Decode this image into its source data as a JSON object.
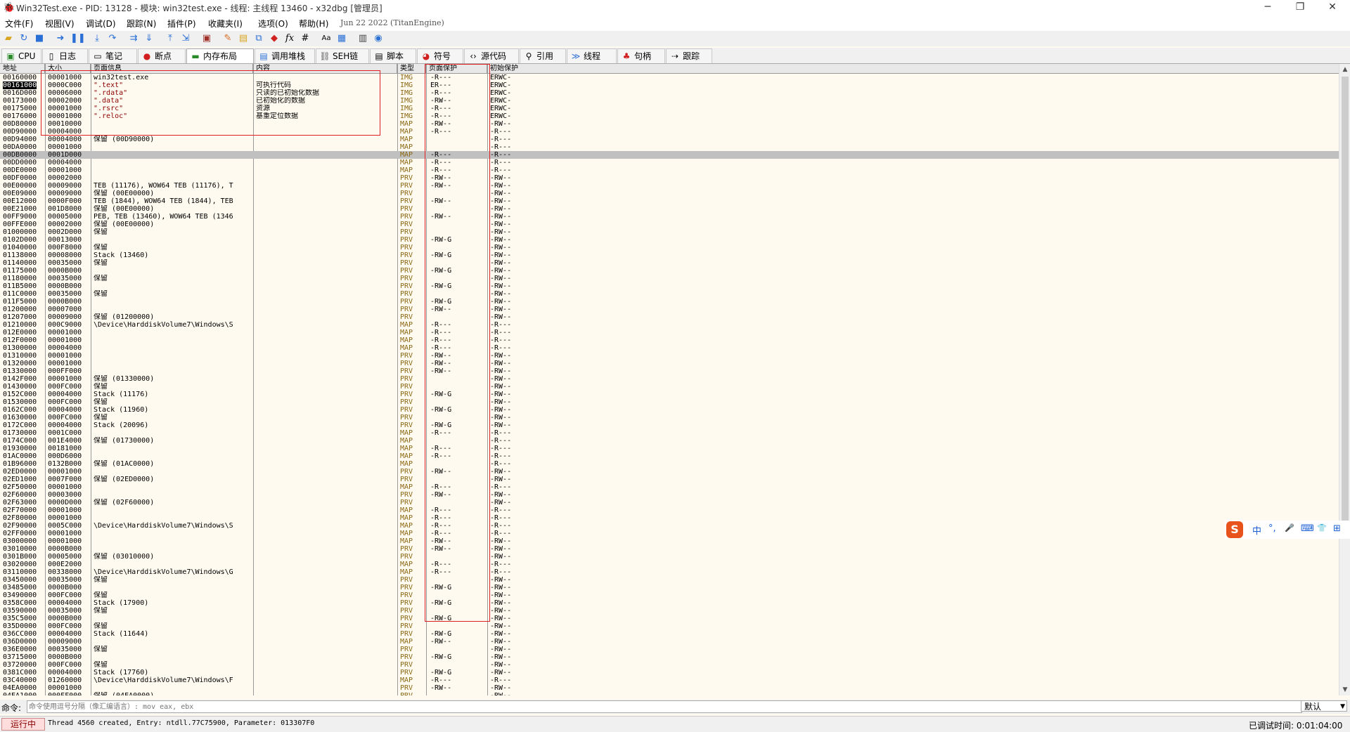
{
  "window": {
    "title": "Win32Test.exe - PID: 13128 - 模块: win32test.exe - 线程: 主线程 13460 - x32dbg [管理员]",
    "minimize": "─",
    "maximize": "❐",
    "close": "✕"
  },
  "menu": {
    "items": [
      "文件(F)",
      "视图(V)",
      "调试(D)",
      "跟踪(N)",
      "插件(P)",
      "收藏夹(I)",
      "选项(O)",
      "帮助(H)"
    ],
    "build": "Jun 22 2022 (TitanEngine)"
  },
  "tabs": [
    {
      "label": "CPU",
      "icon": "cpu-icon"
    },
    {
      "label": "日志",
      "icon": "log-icon"
    },
    {
      "label": "笔记",
      "icon": "notes-icon"
    },
    {
      "label": "断点",
      "icon": "breakpoint-icon"
    },
    {
      "label": "内存布局",
      "icon": "memory-map-icon"
    },
    {
      "label": "调用堆栈",
      "icon": "call-stack-icon"
    },
    {
      "label": "SEH链",
      "icon": "seh-chain-icon"
    },
    {
      "label": "脚本",
      "icon": "script-icon"
    },
    {
      "label": "符号",
      "icon": "symbols-icon"
    },
    {
      "label": "源代码",
      "icon": "source-icon"
    },
    {
      "label": "引用",
      "icon": "references-icon"
    },
    {
      "label": "线程",
      "icon": "threads-icon"
    },
    {
      "label": "句柄",
      "icon": "handles-icon"
    },
    {
      "label": "跟踪",
      "icon": "trace-icon"
    }
  ],
  "table": {
    "headers": [
      "地址",
      "大小",
      "页面信息",
      "内容",
      "类型",
      "页面保护",
      "初始保护"
    ],
    "rows": [
      [
        "00160000",
        "00001000",
        "win32test.exe",
        "",
        "IMG",
        "-R---",
        "ERWC-"
      ],
      [
        "00161000",
        "0000C000",
        "\".text\"",
        "可执行代码",
        "IMG",
        "ER---",
        "ERWC-"
      ],
      [
        "0016D000",
        "00006000",
        "\".rdata\"",
        "只读的已初始化数据",
        "IMG",
        "-R---",
        "ERWC-"
      ],
      [
        "00173000",
        "00002000",
        "\".data\"",
        "已初始化的数据",
        "IMG",
        "-RW--",
        "ERWC-"
      ],
      [
        "00175000",
        "00001000",
        "\".rsrc\"",
        "资源",
        "IMG",
        "-R---",
        "ERWC-"
      ],
      [
        "00176000",
        "00001000",
        "\".reloc\"",
        "基重定位数据",
        "IMG",
        "-R---",
        "ERWC-"
      ],
      [
        "00D80000",
        "00010000",
        "",
        "",
        "MAP",
        "-RW--",
        "-RW--"
      ],
      [
        "00D90000",
        "00004000",
        "",
        "",
        "MAP",
        "-R---",
        "-R---"
      ],
      [
        "00D94000",
        "00004000",
        "保留 (00D90000)",
        "",
        "MAP",
        "",
        "-R---"
      ],
      [
        "00DA0000",
        "00001000",
        "",
        "",
        "MAP",
        "",
        "-R---"
      ],
      [
        "00DB0000",
        "0001D000",
        "",
        "",
        "MAP",
        "-R---",
        "-R---"
      ],
      [
        "00DD0000",
        "00004000",
        "",
        "",
        "MAP",
        "-R---",
        "-R---"
      ],
      [
        "00DE0000",
        "00001000",
        "",
        "",
        "MAP",
        "-R---",
        "-R---"
      ],
      [
        "00DF0000",
        "00002000",
        "",
        "",
        "PRV",
        "-RW--",
        "-RW--"
      ],
      [
        "00E00000",
        "00009000",
        "TEB (11176), WOW64 TEB (11176), T",
        "",
        "PRV",
        "-RW--",
        "-RW--"
      ],
      [
        "00E09000",
        "00009000",
        "保留 (00E00000)",
        "",
        "PRV",
        "",
        "-RW--"
      ],
      [
        "00E12000",
        "0000F000",
        "TEB (1844), WOW64 TEB (1844), TEB",
        "",
        "PRV",
        "-RW--",
        "-RW--"
      ],
      [
        "00E21000",
        "001D8000",
        "保留 (00E00000)",
        "",
        "PRV",
        "",
        "-RW--"
      ],
      [
        "00FF9000",
        "00005000",
        "PEB, TEB (13460), WOW64 TEB (1346",
        "",
        "PRV",
        "-RW--",
        "-RW--"
      ],
      [
        "00FFE000",
        "00002000",
        "保留 (00E00000)",
        "",
        "PRV",
        "",
        "-RW--"
      ],
      [
        "01000000",
        "0002D000",
        "保留",
        "",
        "PRV",
        "",
        "-RW--"
      ],
      [
        "0102D000",
        "00013000",
        "",
        "",
        "PRV",
        "-RW-G",
        "-RW--"
      ],
      [
        "01040000",
        "000F8000",
        "保留",
        "",
        "PRV",
        "",
        "-RW--"
      ],
      [
        "01138000",
        "00008000",
        "Stack (13460)",
        "",
        "PRV",
        "-RW-G",
        "-RW--"
      ],
      [
        "01140000",
        "00035000",
        "保留",
        "",
        "PRV",
        "",
        "-RW--"
      ],
      [
        "01175000",
        "0000B000",
        "",
        "",
        "PRV",
        "-RW-G",
        "-RW--"
      ],
      [
        "01180000",
        "00035000",
        "保留",
        "",
        "PRV",
        "",
        "-RW--"
      ],
      [
        "011B5000",
        "0000B000",
        "",
        "",
        "PRV",
        "-RW-G",
        "-RW--"
      ],
      [
        "011C0000",
        "00035000",
        "保留",
        "",
        "PRV",
        "",
        "-RW--"
      ],
      [
        "011F5000",
        "0000B000",
        "",
        "",
        "PRV",
        "-RW-G",
        "-RW--"
      ],
      [
        "01200000",
        "00007000",
        "",
        "",
        "PRV",
        "-RW--",
        "-RW--"
      ],
      [
        "01207000",
        "00009000",
        "保留 (01200000)",
        "",
        "PRV",
        "",
        "-RW--"
      ],
      [
        "01210000",
        "000C9000",
        "\\Device\\HarddiskVolume7\\Windows\\S",
        "",
        "MAP",
        "-R---",
        "-R---"
      ],
      [
        "012E0000",
        "00001000",
        "",
        "",
        "MAP",
        "-R---",
        "-R---"
      ],
      [
        "012F0000",
        "00001000",
        "",
        "",
        "MAP",
        "-R---",
        "-R---"
      ],
      [
        "01300000",
        "00004000",
        "",
        "",
        "MAP",
        "-R---",
        "-R---"
      ],
      [
        "01310000",
        "00001000",
        "",
        "",
        "PRV",
        "-RW--",
        "-RW--"
      ],
      [
        "01320000",
        "00001000",
        "",
        "",
        "PRV",
        "-RW--",
        "-RW--"
      ],
      [
        "01330000",
        "000FF000",
        "",
        "",
        "PRV",
        "-RW--",
        "-RW--"
      ],
      [
        "0142F000",
        "00001000",
        "保留 (01330000)",
        "",
        "PRV",
        "",
        "-RW--"
      ],
      [
        "01430000",
        "000FC000",
        "保留",
        "",
        "PRV",
        "",
        "-RW--"
      ],
      [
        "0152C000",
        "00004000",
        "Stack (11176)",
        "",
        "PRV",
        "-RW-G",
        "-RW--"
      ],
      [
        "01530000",
        "000FC000",
        "保留",
        "",
        "PRV",
        "",
        "-RW--"
      ],
      [
        "0162C000",
        "00004000",
        "Stack (11960)",
        "",
        "PRV",
        "-RW-G",
        "-RW--"
      ],
      [
        "01630000",
        "000FC000",
        "保留",
        "",
        "PRV",
        "",
        "-RW--"
      ],
      [
        "0172C000",
        "00004000",
        "Stack (20096)",
        "",
        "PRV",
        "-RW-G",
        "-RW--"
      ],
      [
        "01730000",
        "0001C000",
        "",
        "",
        "MAP",
        "-R---",
        "-R---"
      ],
      [
        "0174C000",
        "001E4000",
        "保留 (01730000)",
        "",
        "MAP",
        "",
        "-R---"
      ],
      [
        "01930000",
        "00181000",
        "",
        "",
        "MAP",
        "-R---",
        "-R---"
      ],
      [
        "01AC0000",
        "000D6000",
        "",
        "",
        "MAP",
        "-R---",
        "-R---"
      ],
      [
        "01B96000",
        "0132B000",
        "保留 (01AC0000)",
        "",
        "MAP",
        "",
        "-R---"
      ],
      [
        "02ED0000",
        "00001000",
        "",
        "",
        "PRV",
        "-RW--",
        "-RW--"
      ],
      [
        "02ED1000",
        "0007F000",
        "保留 (02ED0000)",
        "",
        "PRV",
        "",
        "-RW--"
      ],
      [
        "02F50000",
        "00001000",
        "",
        "",
        "MAP",
        "-R---",
        "-R---"
      ],
      [
        "02F60000",
        "00003000",
        "",
        "",
        "PRV",
        "-RW--",
        "-RW--"
      ],
      [
        "02F63000",
        "0000D000",
        "保留 (02F60000)",
        "",
        "PRV",
        "",
        "-RW--"
      ],
      [
        "02F70000",
        "00001000",
        "",
        "",
        "MAP",
        "-R---",
        "-R---"
      ],
      [
        "02F80000",
        "00001000",
        "",
        "",
        "MAP",
        "-R---",
        "-R---"
      ],
      [
        "02F90000",
        "0005C000",
        "\\Device\\HarddiskVolume7\\Windows\\S",
        "",
        "MAP",
        "-R---",
        "-R---"
      ],
      [
        "02FF0000",
        "00001000",
        "",
        "",
        "MAP",
        "-R---",
        "-R---"
      ],
      [
        "03000000",
        "00001000",
        "",
        "",
        "MAP",
        "-RW--",
        "-RW--"
      ],
      [
        "03010000",
        "0000B000",
        "",
        "",
        "PRV",
        "-RW--",
        "-RW--"
      ],
      [
        "0301B000",
        "00005000",
        "保留 (03010000)",
        "",
        "PRV",
        "",
        "-RW--"
      ],
      [
        "03020000",
        "000E2000",
        "",
        "",
        "MAP",
        "-R---",
        "-R---"
      ],
      [
        "03110000",
        "00338000",
        "\\Device\\HarddiskVolume7\\Windows\\G",
        "",
        "MAP",
        "-R---",
        "-R---"
      ],
      [
        "03450000",
        "00035000",
        "保留",
        "",
        "PRV",
        "",
        "-RW--"
      ],
      [
        "03485000",
        "0000B000",
        "",
        "",
        "PRV",
        "-RW-G",
        "-RW--"
      ],
      [
        "03490000",
        "000FC000",
        "保留",
        "",
        "PRV",
        "",
        "-RW--"
      ],
      [
        "0358C000",
        "00004000",
        "Stack (17900)",
        "",
        "PRV",
        "-RW-G",
        "-RW--"
      ],
      [
        "03590000",
        "00035000",
        "保留",
        "",
        "PRV",
        "",
        "-RW--"
      ],
      [
        "035C5000",
        "0000B000",
        "",
        "",
        "PRV",
        "-RW-G",
        "-RW--"
      ],
      [
        "035D0000",
        "000FC000",
        "保留",
        "",
        "PRV",
        "",
        "-RW--"
      ],
      [
        "036CC000",
        "00004000",
        "Stack (11644)",
        "",
        "PRV",
        "-RW-G",
        "-RW--"
      ],
      [
        "036D0000",
        "00009000",
        "",
        "",
        "MAP",
        "-RW--",
        "-RW--"
      ],
      [
        "036E0000",
        "00035000",
        "保留",
        "",
        "PRV",
        "",
        "-RW--"
      ],
      [
        "03715000",
        "0000B000",
        "",
        "",
        "PRV",
        "-RW-G",
        "-RW--"
      ],
      [
        "03720000",
        "000FC000",
        "保留",
        "",
        "PRV",
        "",
        "-RW--"
      ],
      [
        "0381C000",
        "00004000",
        "Stack (17760)",
        "",
        "PRV",
        "-RW-G",
        "-RW--"
      ],
      [
        "03C40000",
        "01260000",
        "\\Device\\HarddiskVolume7\\Windows\\F",
        "",
        "MAP",
        "-R---",
        "-R---"
      ],
      [
        "04EA0000",
        "00001000",
        "",
        "",
        "PRV",
        "-RW--",
        "-RW--"
      ],
      [
        "04EA1000",
        "000FF000",
        "保留 (04EA0000)",
        "",
        "PRV",
        "",
        "-RW--"
      ]
    ]
  },
  "command": {
    "label": "命令:",
    "placeholder": "命令使用逗号分隔（像汇编语言）: mov eax, ebx",
    "mode": "默认"
  },
  "status": {
    "state": "运行中",
    "message": "Thread 4560 created, Entry: ntdll.77C75900, Parameter: 013307F0",
    "debug_time": "已调试时间: 0:01:04:00"
  },
  "ime": {
    "logo": "S",
    "items": [
      "中",
      "°,",
      "🎤",
      "⌨",
      "👕",
      "⊞"
    ]
  }
}
